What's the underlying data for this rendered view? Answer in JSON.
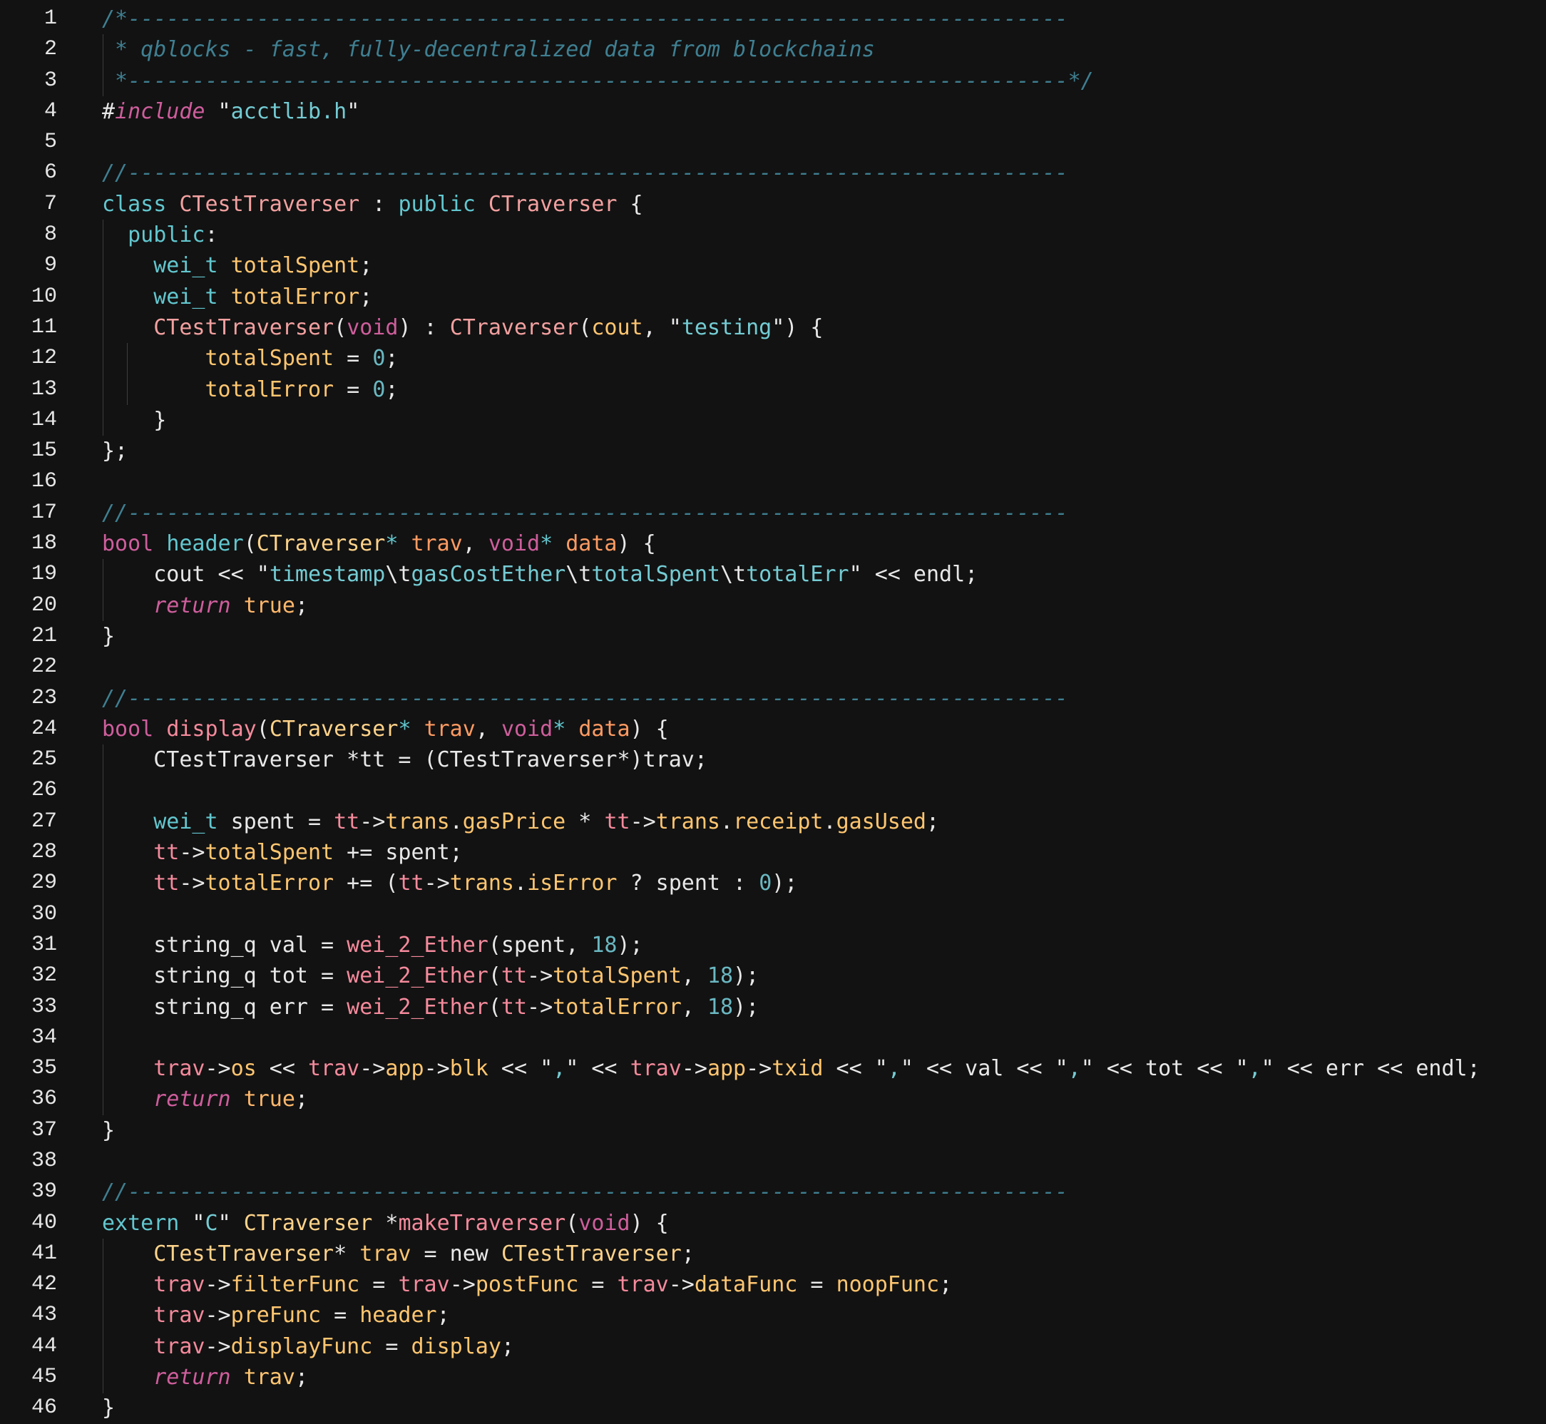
{
  "colors": {
    "background": "#121212",
    "comment": "#3f7f91",
    "keyword": "#62c7cf",
    "storage_keyword": "#ce5e9c",
    "class_name": "#f3a0a0",
    "type_name": "#ffd38a",
    "member": "#ffc670",
    "string": "#74ccd4",
    "number": "#6ab8c2",
    "function": "#ffd38a",
    "call": "#f58a9c",
    "plain": "#e8e8e8",
    "literal": "#ffb86c",
    "parameter": "#ff9b62",
    "line_number": "#e6e6e6",
    "indent_guide": "#3d3d3d"
  },
  "lines": [
    {
      "n": "1",
      "tokens": [
        [
          "cm",
          "/*-------------------------------------------------------------------------"
        ]
      ]
    },
    {
      "n": "2",
      "tokens": [
        [
          "cm",
          " * qblocks - fast, fully-decentralized data from blockchains"
        ]
      ]
    },
    {
      "n": "3",
      "tokens": [
        [
          "cm",
          " *-------------------------------------------------------------------------*/"
        ]
      ]
    },
    {
      "n": "4",
      "tokens": [
        [
          "pl",
          "#"
        ],
        [
          "kwi",
          "include"
        ],
        [
          "pl",
          " \""
        ],
        [
          "str",
          "acctlib.h"
        ],
        [
          "pl",
          "\""
        ]
      ]
    },
    {
      "n": "5",
      "tokens": []
    },
    {
      "n": "6",
      "tokens": [
        [
          "cm",
          "//-------------------------------------------------------------------------"
        ]
      ]
    },
    {
      "n": "7",
      "tokens": [
        [
          "kw",
          "class"
        ],
        [
          "pl",
          " "
        ],
        [
          "cls",
          "CTestTraverser"
        ],
        [
          "pl",
          " : "
        ],
        [
          "kw",
          "public"
        ],
        [
          "pl",
          " "
        ],
        [
          "cls",
          "CTraverser"
        ],
        [
          "pl",
          " {"
        ]
      ]
    },
    {
      "n": "8",
      "tokens": [
        [
          "pl",
          "  "
        ],
        [
          "kw",
          "public"
        ],
        [
          "pl",
          ":"
        ]
      ]
    },
    {
      "n": "9",
      "tokens": [
        [
          "pl",
          "    "
        ],
        [
          "kw",
          "wei_t"
        ],
        [
          "pl",
          " "
        ],
        [
          "var",
          "totalSpent"
        ],
        [
          "pl",
          ";"
        ]
      ]
    },
    {
      "n": "10",
      "tokens": [
        [
          "pl",
          "    "
        ],
        [
          "kw",
          "wei_t"
        ],
        [
          "pl",
          " "
        ],
        [
          "var",
          "totalError"
        ],
        [
          "pl",
          ";"
        ]
      ]
    },
    {
      "n": "11",
      "tokens": [
        [
          "pl",
          "    "
        ],
        [
          "cls",
          "CTestTraverser"
        ],
        [
          "pl",
          "("
        ],
        [
          "kwr",
          "void"
        ],
        [
          "pl",
          ") : "
        ],
        [
          "cls",
          "CTraverser"
        ],
        [
          "pl",
          "("
        ],
        [
          "var",
          "cout"
        ],
        [
          "pl",
          ", \""
        ],
        [
          "str",
          "testing"
        ],
        [
          "pl",
          "\") {"
        ]
      ]
    },
    {
      "n": "12",
      "tokens": [
        [
          "pl",
          "        "
        ],
        [
          "var",
          "totalSpent"
        ],
        [
          "pl",
          " = "
        ],
        [
          "num",
          "0"
        ],
        [
          "pl",
          ";"
        ]
      ]
    },
    {
      "n": "13",
      "tokens": [
        [
          "pl",
          "        "
        ],
        [
          "var",
          "totalError"
        ],
        [
          "pl",
          " = "
        ],
        [
          "num",
          "0"
        ],
        [
          "pl",
          ";"
        ]
      ]
    },
    {
      "n": "14",
      "tokens": [
        [
          "pl",
          "    }"
        ]
      ]
    },
    {
      "n": "15",
      "tokens": [
        [
          "pl",
          "};"
        ]
      ]
    },
    {
      "n": "16",
      "tokens": []
    },
    {
      "n": "17",
      "tokens": [
        [
          "cm",
          "//-------------------------------------------------------------------------"
        ]
      ]
    },
    {
      "n": "18",
      "tokens": [
        [
          "kwr",
          "bool"
        ],
        [
          "pl",
          " "
        ],
        [
          "kw",
          "header"
        ],
        [
          "pl",
          "("
        ],
        [
          "typ",
          "CTraverser"
        ],
        [
          "kw",
          "*"
        ],
        [
          "pl",
          " "
        ],
        [
          "prm",
          "trav"
        ],
        [
          "pl",
          ", "
        ],
        [
          "kwr",
          "void"
        ],
        [
          "kw",
          "*"
        ],
        [
          "pl",
          " "
        ],
        [
          "prm",
          "data"
        ],
        [
          "pl",
          ") {"
        ]
      ]
    },
    {
      "n": "19",
      "tokens": [
        [
          "pl",
          "    cout << \""
        ],
        [
          "str",
          "timestamp"
        ],
        [
          "pl",
          "\\t"
        ],
        [
          "str",
          "gasCostEther"
        ],
        [
          "pl",
          "\\t"
        ],
        [
          "str",
          "totalSpent"
        ],
        [
          "pl",
          "\\t"
        ],
        [
          "str",
          "totalErr"
        ],
        [
          "pl",
          "\" << endl;"
        ]
      ]
    },
    {
      "n": "20",
      "tokens": [
        [
          "pl",
          "    "
        ],
        [
          "kwi",
          "return"
        ],
        [
          "pl",
          " "
        ],
        [
          "lit",
          "true"
        ],
        [
          "pl",
          ";"
        ]
      ]
    },
    {
      "n": "21",
      "tokens": [
        [
          "pl",
          "}"
        ]
      ]
    },
    {
      "n": "22",
      "tokens": []
    },
    {
      "n": "23",
      "tokens": [
        [
          "cm",
          "//-------------------------------------------------------------------------"
        ]
      ]
    },
    {
      "n": "24",
      "tokens": [
        [
          "kwr",
          "bool"
        ],
        [
          "pl",
          " "
        ],
        [
          "fnp",
          "display"
        ],
        [
          "pl",
          "("
        ],
        [
          "typ",
          "CTraverser"
        ],
        [
          "kw",
          "*"
        ],
        [
          "pl",
          " "
        ],
        [
          "prm",
          "trav"
        ],
        [
          "pl",
          ", "
        ],
        [
          "kwr",
          "void"
        ],
        [
          "kw",
          "*"
        ],
        [
          "pl",
          " "
        ],
        [
          "prm",
          "data"
        ],
        [
          "pl",
          ") {"
        ]
      ]
    },
    {
      "n": "25",
      "tokens": [
        [
          "pl",
          "    CTestTraverser *tt = (CTestTraverser*)trav;"
        ]
      ]
    },
    {
      "n": "26",
      "tokens": []
    },
    {
      "n": "27",
      "tokens": [
        [
          "pl",
          "    "
        ],
        [
          "kw",
          "wei_t"
        ],
        [
          "pl",
          " spent = "
        ],
        [
          "fnp",
          "tt"
        ],
        [
          "pl",
          "->"
        ],
        [
          "var",
          "trans"
        ],
        [
          "pl",
          "."
        ],
        [
          "var",
          "gasPrice"
        ],
        [
          "pl",
          " * "
        ],
        [
          "fnp",
          "tt"
        ],
        [
          "pl",
          "->"
        ],
        [
          "var",
          "trans"
        ],
        [
          "pl",
          "."
        ],
        [
          "var",
          "receipt"
        ],
        [
          "pl",
          "."
        ],
        [
          "var",
          "gasUsed"
        ],
        [
          "pl",
          ";"
        ]
      ]
    },
    {
      "n": "28",
      "tokens": [
        [
          "pl",
          "    "
        ],
        [
          "fnp",
          "tt"
        ],
        [
          "pl",
          "->"
        ],
        [
          "var",
          "totalSpent"
        ],
        [
          "pl",
          " += spent;"
        ]
      ]
    },
    {
      "n": "29",
      "tokens": [
        [
          "pl",
          "    "
        ],
        [
          "fnp",
          "tt"
        ],
        [
          "pl",
          "->"
        ],
        [
          "var",
          "totalError"
        ],
        [
          "pl",
          " += ("
        ],
        [
          "fnp",
          "tt"
        ],
        [
          "pl",
          "->"
        ],
        [
          "var",
          "trans"
        ],
        [
          "pl",
          "."
        ],
        [
          "var",
          "isError"
        ],
        [
          "pl",
          " ? spent : "
        ],
        [
          "num",
          "0"
        ],
        [
          "pl",
          ");"
        ]
      ]
    },
    {
      "n": "30",
      "tokens": []
    },
    {
      "n": "31",
      "tokens": [
        [
          "pl",
          "    string_q val = "
        ],
        [
          "fnp",
          "wei_2_Ether"
        ],
        [
          "pl",
          "(spent, "
        ],
        [
          "num",
          "18"
        ],
        [
          "pl",
          ");"
        ]
      ]
    },
    {
      "n": "32",
      "tokens": [
        [
          "pl",
          "    string_q tot = "
        ],
        [
          "fnp",
          "wei_2_Ether"
        ],
        [
          "pl",
          "("
        ],
        [
          "fnp",
          "tt"
        ],
        [
          "pl",
          "->"
        ],
        [
          "var",
          "totalSpent"
        ],
        [
          "pl",
          ", "
        ],
        [
          "num",
          "18"
        ],
        [
          "pl",
          ");"
        ]
      ]
    },
    {
      "n": "33",
      "tokens": [
        [
          "pl",
          "    string_q err = "
        ],
        [
          "fnp",
          "wei_2_Ether"
        ],
        [
          "pl",
          "("
        ],
        [
          "fnp",
          "tt"
        ],
        [
          "pl",
          "->"
        ],
        [
          "var",
          "totalError"
        ],
        [
          "pl",
          ", "
        ],
        [
          "num",
          "18"
        ],
        [
          "pl",
          ");"
        ]
      ]
    },
    {
      "n": "34",
      "tokens": []
    },
    {
      "n": "35",
      "tokens": [
        [
          "pl",
          "    "
        ],
        [
          "fnp",
          "trav"
        ],
        [
          "pl",
          "->"
        ],
        [
          "var",
          "os"
        ],
        [
          "pl",
          " << "
        ],
        [
          "fnp",
          "trav"
        ],
        [
          "pl",
          "->"
        ],
        [
          "var",
          "app"
        ],
        [
          "pl",
          "->"
        ],
        [
          "var",
          "blk"
        ],
        [
          "pl",
          " << \""
        ],
        [
          "str",
          ","
        ],
        [
          "pl",
          "\" << "
        ],
        [
          "fnp",
          "trav"
        ],
        [
          "pl",
          "->"
        ],
        [
          "var",
          "app"
        ],
        [
          "pl",
          "->"
        ],
        [
          "var",
          "txid"
        ],
        [
          "pl",
          " << \""
        ],
        [
          "str",
          ","
        ],
        [
          "pl",
          "\" << val << \""
        ],
        [
          "str",
          ","
        ],
        [
          "pl",
          "\" << tot << \""
        ],
        [
          "str",
          ","
        ],
        [
          "pl",
          "\" << err << endl;"
        ]
      ]
    },
    {
      "n": "36",
      "tokens": [
        [
          "pl",
          "    "
        ],
        [
          "kwi",
          "return"
        ],
        [
          "pl",
          " "
        ],
        [
          "lit",
          "true"
        ],
        [
          "pl",
          ";"
        ]
      ]
    },
    {
      "n": "37",
      "tokens": [
        [
          "pl",
          "}"
        ]
      ]
    },
    {
      "n": "38",
      "tokens": []
    },
    {
      "n": "39",
      "tokens": [
        [
          "cm",
          "//-------------------------------------------------------------------------"
        ]
      ]
    },
    {
      "n": "40",
      "tokens": [
        [
          "kw",
          "extern"
        ],
        [
          "pl",
          " \""
        ],
        [
          "str",
          "C"
        ],
        [
          "pl",
          "\" "
        ],
        [
          "typ",
          "CTraverser"
        ],
        [
          "pl",
          " *"
        ],
        [
          "fnp",
          "makeTraverser"
        ],
        [
          "pl",
          "("
        ],
        [
          "kwr",
          "void"
        ],
        [
          "pl",
          ") {"
        ]
      ]
    },
    {
      "n": "41",
      "tokens": [
        [
          "pl",
          "    "
        ],
        [
          "typ",
          "CTestTraverser"
        ],
        [
          "pl",
          "* "
        ],
        [
          "var",
          "trav"
        ],
        [
          "pl",
          " = new "
        ],
        [
          "typ",
          "CTestTraverser"
        ],
        [
          "pl",
          ";"
        ]
      ]
    },
    {
      "n": "42",
      "tokens": [
        [
          "pl",
          "    "
        ],
        [
          "fnp",
          "trav"
        ],
        [
          "pl",
          "->"
        ],
        [
          "var",
          "filterFunc"
        ],
        [
          "pl",
          " = "
        ],
        [
          "fnp",
          "trav"
        ],
        [
          "pl",
          "->"
        ],
        [
          "var",
          "postFunc"
        ],
        [
          "pl",
          " = "
        ],
        [
          "fnp",
          "trav"
        ],
        [
          "pl",
          "->"
        ],
        [
          "var",
          "dataFunc"
        ],
        [
          "pl",
          " = "
        ],
        [
          "var",
          "noopFunc"
        ],
        [
          "pl",
          ";"
        ]
      ]
    },
    {
      "n": "43",
      "tokens": [
        [
          "pl",
          "    "
        ],
        [
          "fnp",
          "trav"
        ],
        [
          "pl",
          "->"
        ],
        [
          "var",
          "preFunc"
        ],
        [
          "pl",
          " = "
        ],
        [
          "var",
          "header"
        ],
        [
          "pl",
          ";"
        ]
      ]
    },
    {
      "n": "44",
      "tokens": [
        [
          "pl",
          "    "
        ],
        [
          "fnp",
          "trav"
        ],
        [
          "pl",
          "->"
        ],
        [
          "var",
          "displayFunc"
        ],
        [
          "pl",
          " = "
        ],
        [
          "var",
          "display"
        ],
        [
          "pl",
          ";"
        ]
      ]
    },
    {
      "n": "45",
      "tokens": [
        [
          "pl",
          "    "
        ],
        [
          "kwi",
          "return"
        ],
        [
          "pl",
          " "
        ],
        [
          "var",
          "trav"
        ],
        [
          "pl",
          ";"
        ]
      ]
    },
    {
      "n": "46",
      "tokens": [
        [
          "pl",
          "}"
        ]
      ]
    }
  ]
}
